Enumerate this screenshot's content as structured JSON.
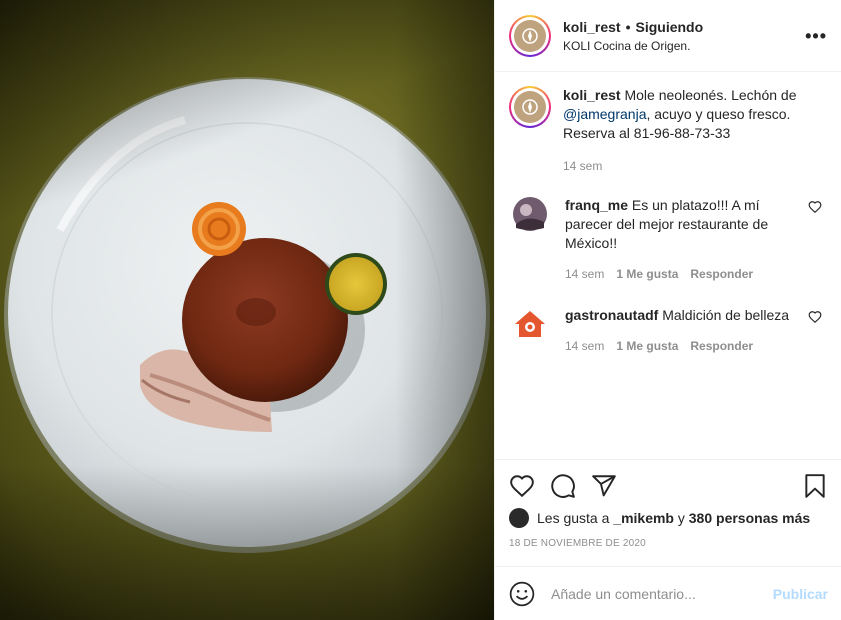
{
  "post": {
    "username": "koli_rest",
    "separator": "•",
    "follow_status": "Siguiendo",
    "location": "KOLI Cocina de Origen.",
    "more_label": "•••"
  },
  "caption": {
    "username": "koli_rest",
    "text_before": "Mole neoleonés. Lechón de",
    "mention": "@jamegranja",
    "text_after": ", acuyo y queso fresco. Reserva al 81-96-88-73-33",
    "time": "14 sem"
  },
  "comments": [
    {
      "username": "franq_me",
      "text": "Es un platazo!!! A mí parecer del mejor restaurante de México!!",
      "time": "14 sem",
      "likes": "1 Me gusta",
      "reply": "Responder"
    },
    {
      "username": "gastronautadf",
      "text": "Maldición de belleza",
      "time": "14 sem",
      "likes": "1 Me gusta",
      "reply": "Responder"
    }
  ],
  "likes": {
    "prefix": "Les gusta a",
    "user": "_mikemb",
    "joiner": "y",
    "others": "380 personas más"
  },
  "date": "18 DE NOVIEMBRE DE 2020",
  "add_comment": {
    "placeholder": "Añade un comentario...",
    "post_label": "Publicar"
  },
  "icons": {
    "like": "heart-icon",
    "comment": "comment-icon",
    "share": "share-icon",
    "save": "bookmark-icon",
    "emoji": "emoji-icon",
    "more": "more-icon"
  },
  "colors": {
    "link": "#00376b",
    "muted": "#8e8e8e",
    "publish_disabled": "#b3dbff",
    "text": "#262626"
  }
}
